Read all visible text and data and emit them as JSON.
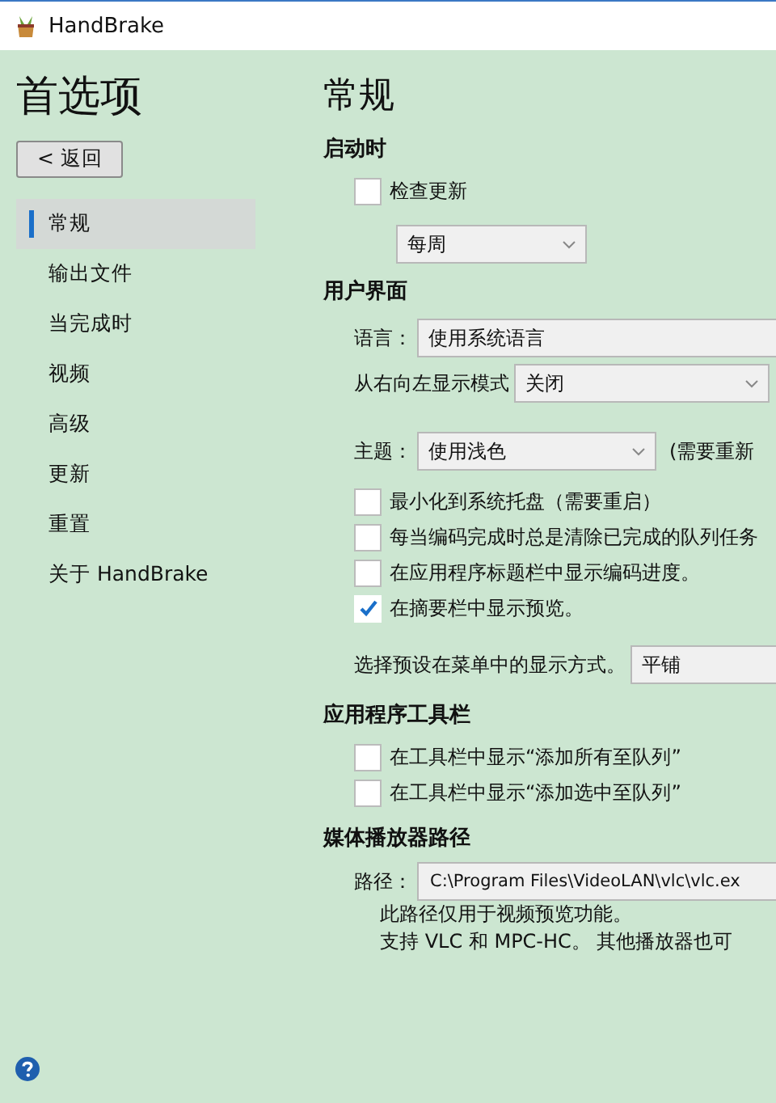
{
  "window": {
    "title": "HandBrake"
  },
  "sidebar": {
    "title": "首选项",
    "back_button": "< 返回",
    "items": [
      {
        "label": "常规",
        "selected": true
      },
      {
        "label": "输出文件",
        "selected": false
      },
      {
        "label": "当完成时",
        "selected": false
      },
      {
        "label": "视频",
        "selected": false
      },
      {
        "label": "高级",
        "selected": false
      },
      {
        "label": "更新",
        "selected": false
      },
      {
        "label": "重置",
        "selected": false
      },
      {
        "label": "关于 HandBrake",
        "selected": false
      }
    ]
  },
  "page_title": "常规",
  "sections": [
    {
      "heading": "启动时",
      "rows": [
        {
          "kind": "checkbox",
          "label": "检查更新",
          "checked": false
        },
        {
          "kind": "select",
          "value": "每周",
          "arrow": true
        }
      ]
    },
    {
      "heading": "用户界面",
      "rows": [
        {
          "kind": "select",
          "label": "语言：",
          "value": "使用系统语言",
          "arrow": false
        },
        {
          "kind": "select",
          "label": "从右向左显示模式",
          "value": "关闭",
          "arrow": true
        },
        {
          "kind": "select",
          "label": "主题：",
          "value": "使用浅色",
          "arrow": true,
          "note": "(需要重新"
        },
        {
          "kind": "checkbox",
          "label": "最小化到系统托盘（需要重启）",
          "checked": false
        },
        {
          "kind": "checkbox",
          "label": "每当编码完成时总是清除已完成的队列任务",
          "checked": false
        },
        {
          "kind": "checkbox",
          "label": "在应用程序标题栏中显示编码进度。",
          "checked": false
        },
        {
          "kind": "checkbox",
          "label": "在摘要栏中显示预览。",
          "checked": true
        },
        {
          "kind": "select",
          "label": "选择预设在菜单中的显示方式。",
          "value": "平铺",
          "arrow": false
        }
      ]
    },
    {
      "heading": "应用程序工具栏",
      "rows": [
        {
          "kind": "checkbox",
          "label": "在工具栏中显示“添加所有至队列”",
          "checked": false
        },
        {
          "kind": "checkbox",
          "label": "在工具栏中显示“添加选中至队列”",
          "checked": false
        }
      ]
    },
    {
      "heading": "媒体播放器路径",
      "rows": [
        {
          "kind": "field",
          "label": "路径：",
          "value": "C:\\Program Files\\VideoLAN\\vlc\\vlc.ex"
        },
        {
          "kind": "text",
          "text": "此路径仅用于视频预览功能。"
        },
        {
          "kind": "text",
          "text": "支持 VLC 和 MPC-HC。 其他播放器也可"
        }
      ]
    }
  ]
}
